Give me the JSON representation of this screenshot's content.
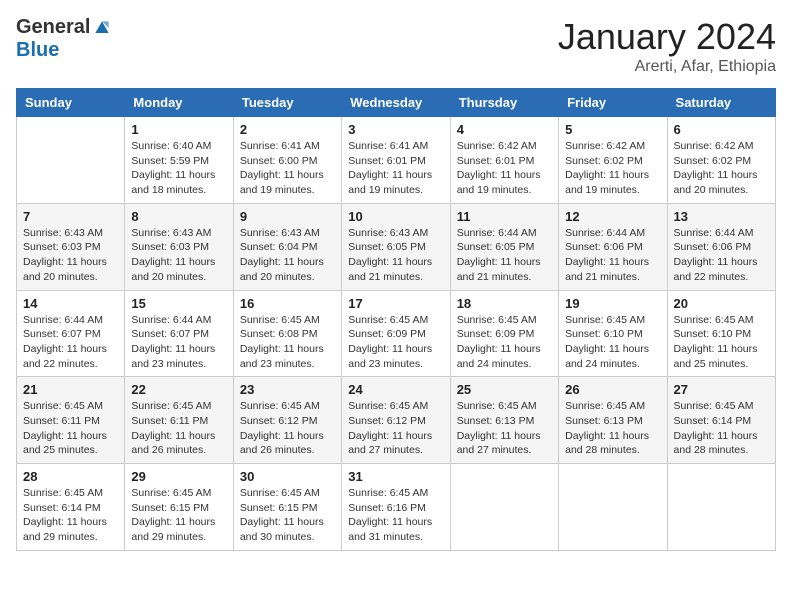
{
  "header": {
    "logo_general": "General",
    "logo_blue": "Blue",
    "month_title": "January 2024",
    "location": "Arerti, Afar, Ethiopia"
  },
  "weekdays": [
    "Sunday",
    "Monday",
    "Tuesday",
    "Wednesday",
    "Thursday",
    "Friday",
    "Saturday"
  ],
  "weeks": [
    [
      null,
      {
        "day": "1",
        "sunrise": "6:40 AM",
        "sunset": "5:59 PM",
        "daylight": "11 hours and 18 minutes."
      },
      {
        "day": "2",
        "sunrise": "6:41 AM",
        "sunset": "6:00 PM",
        "daylight": "11 hours and 19 minutes."
      },
      {
        "day": "3",
        "sunrise": "6:41 AM",
        "sunset": "6:01 PM",
        "daylight": "11 hours and 19 minutes."
      },
      {
        "day": "4",
        "sunrise": "6:42 AM",
        "sunset": "6:01 PM",
        "daylight": "11 hours and 19 minutes."
      },
      {
        "day": "5",
        "sunrise": "6:42 AM",
        "sunset": "6:02 PM",
        "daylight": "11 hours and 19 minutes."
      },
      {
        "day": "6",
        "sunrise": "6:42 AM",
        "sunset": "6:02 PM",
        "daylight": "11 hours and 20 minutes."
      }
    ],
    [
      {
        "day": "7",
        "sunrise": "6:43 AM",
        "sunset": "6:03 PM",
        "daylight": "11 hours and 20 minutes."
      },
      {
        "day": "8",
        "sunrise": "6:43 AM",
        "sunset": "6:03 PM",
        "daylight": "11 hours and 20 minutes."
      },
      {
        "day": "9",
        "sunrise": "6:43 AM",
        "sunset": "6:04 PM",
        "daylight": "11 hours and 20 minutes."
      },
      {
        "day": "10",
        "sunrise": "6:43 AM",
        "sunset": "6:05 PM",
        "daylight": "11 hours and 21 minutes."
      },
      {
        "day": "11",
        "sunrise": "6:44 AM",
        "sunset": "6:05 PM",
        "daylight": "11 hours and 21 minutes."
      },
      {
        "day": "12",
        "sunrise": "6:44 AM",
        "sunset": "6:06 PM",
        "daylight": "11 hours and 21 minutes."
      },
      {
        "day": "13",
        "sunrise": "6:44 AM",
        "sunset": "6:06 PM",
        "daylight": "11 hours and 22 minutes."
      }
    ],
    [
      {
        "day": "14",
        "sunrise": "6:44 AM",
        "sunset": "6:07 PM",
        "daylight": "11 hours and 22 minutes."
      },
      {
        "day": "15",
        "sunrise": "6:44 AM",
        "sunset": "6:07 PM",
        "daylight": "11 hours and 23 minutes."
      },
      {
        "day": "16",
        "sunrise": "6:45 AM",
        "sunset": "6:08 PM",
        "daylight": "11 hours and 23 minutes."
      },
      {
        "day": "17",
        "sunrise": "6:45 AM",
        "sunset": "6:09 PM",
        "daylight": "11 hours and 23 minutes."
      },
      {
        "day": "18",
        "sunrise": "6:45 AM",
        "sunset": "6:09 PM",
        "daylight": "11 hours and 24 minutes."
      },
      {
        "day": "19",
        "sunrise": "6:45 AM",
        "sunset": "6:10 PM",
        "daylight": "11 hours and 24 minutes."
      },
      {
        "day": "20",
        "sunrise": "6:45 AM",
        "sunset": "6:10 PM",
        "daylight": "11 hours and 25 minutes."
      }
    ],
    [
      {
        "day": "21",
        "sunrise": "6:45 AM",
        "sunset": "6:11 PM",
        "daylight": "11 hours and 25 minutes."
      },
      {
        "day": "22",
        "sunrise": "6:45 AM",
        "sunset": "6:11 PM",
        "daylight": "11 hours and 26 minutes."
      },
      {
        "day": "23",
        "sunrise": "6:45 AM",
        "sunset": "6:12 PM",
        "daylight": "11 hours and 26 minutes."
      },
      {
        "day": "24",
        "sunrise": "6:45 AM",
        "sunset": "6:12 PM",
        "daylight": "11 hours and 27 minutes."
      },
      {
        "day": "25",
        "sunrise": "6:45 AM",
        "sunset": "6:13 PM",
        "daylight": "11 hours and 27 minutes."
      },
      {
        "day": "26",
        "sunrise": "6:45 AM",
        "sunset": "6:13 PM",
        "daylight": "11 hours and 28 minutes."
      },
      {
        "day": "27",
        "sunrise": "6:45 AM",
        "sunset": "6:14 PM",
        "daylight": "11 hours and 28 minutes."
      }
    ],
    [
      {
        "day": "28",
        "sunrise": "6:45 AM",
        "sunset": "6:14 PM",
        "daylight": "11 hours and 29 minutes."
      },
      {
        "day": "29",
        "sunrise": "6:45 AM",
        "sunset": "6:15 PM",
        "daylight": "11 hours and 29 minutes."
      },
      {
        "day": "30",
        "sunrise": "6:45 AM",
        "sunset": "6:15 PM",
        "daylight": "11 hours and 30 minutes."
      },
      {
        "day": "31",
        "sunrise": "6:45 AM",
        "sunset": "6:16 PM",
        "daylight": "11 hours and 31 minutes."
      },
      null,
      null,
      null
    ]
  ],
  "labels": {
    "sunrise": "Sunrise:",
    "sunset": "Sunset:",
    "daylight": "Daylight:"
  }
}
